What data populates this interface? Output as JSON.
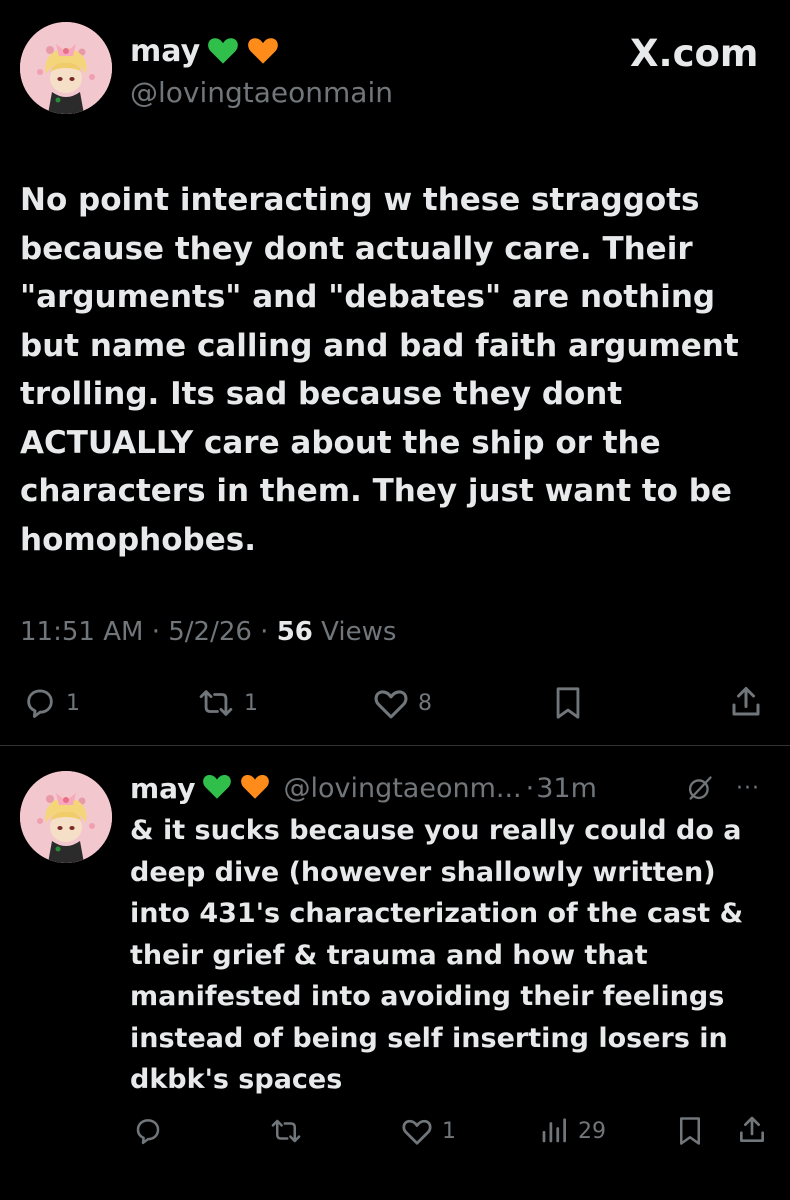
{
  "main_tweet": {
    "display_name": "may",
    "hearts": [
      "green-heart",
      "orange-heart"
    ],
    "handle": "@lovingtaeonmain",
    "site": "X.com",
    "text": "No point interacting w these straggots\nbecause they dont actually care. Their\n\"arguments\" and \"debates\" are nothing\nbut name calling and bad faith argument\ntrolling. Its sad because they dont\nACTUALLY care about the ship or the\ncharacters in them. They just want to be\nhomophobes.",
    "time": "11:51 AM",
    "date": "5/2/26",
    "views_count": "56",
    "views_label": "Views",
    "sep": "·",
    "actions": {
      "replies": "1",
      "reposts": "1",
      "likes": "8"
    }
  },
  "reply_tweet": {
    "display_name": "may",
    "hearts": [
      "green-heart",
      "orange-heart"
    ],
    "handle": "@lovingtaeonm...",
    "sep": "·",
    "time": "31m",
    "more": "···",
    "text": "& it sucks because you really could do a\ndeep dive (however shallowly written)\ninto 431's characterization of the cast &\ntheir grief & trauma and how that\nmanifested into avoiding their feelings\ninstead of being self inserting losers in\ndkbk's spaces",
    "actions": {
      "likes": "1",
      "views": "29"
    }
  },
  "colors": {
    "background": "#000000",
    "text": "#e7e9ea",
    "muted": "#71767b",
    "divider": "#2f3336",
    "green_heart": "#2fbf4a",
    "orange_heart": "#ff8c1a"
  },
  "icons": {
    "x_logo": "x-logo-icon",
    "reply": "reply-icon",
    "repost": "repost-icon",
    "like": "heart-icon",
    "bookmark": "bookmark-icon",
    "share": "share-icon",
    "views": "views-chart-icon",
    "grok": "grok-icon",
    "more": "more-icon"
  }
}
